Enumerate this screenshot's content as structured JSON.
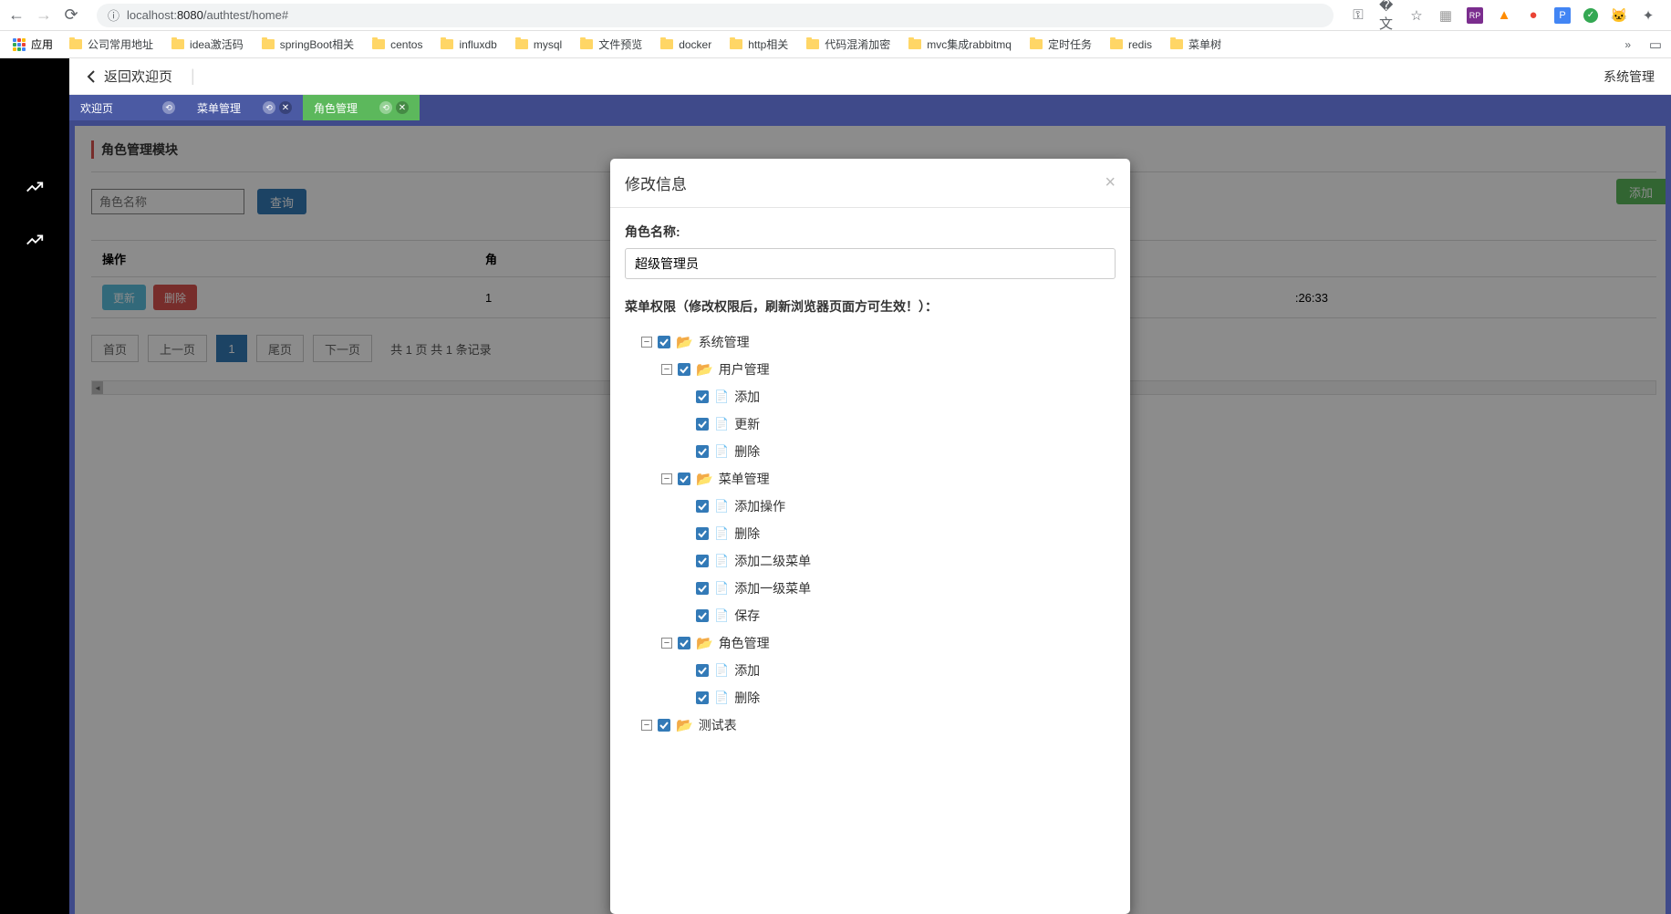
{
  "browser": {
    "url_host": "localhost:",
    "url_port": "8080",
    "url_path": "/authtest/home#"
  },
  "bookmarks": {
    "apps_label": "应用",
    "items": [
      "公司常用地址",
      "idea激活码",
      "springBoot相关",
      "centos",
      "influxdb",
      "mysql",
      "文件预览",
      "docker",
      "http相关",
      "代码混淆加密",
      "mvc集成rabbitmq",
      "定时任务",
      "redis",
      "菜单树"
    ],
    "more": "»"
  },
  "header": {
    "back_label": "返回欢迎页",
    "right_label": "系统管理"
  },
  "tabs": [
    {
      "label": "欢迎页",
      "active": false,
      "closable": false
    },
    {
      "label": "菜单管理",
      "active": false,
      "closable": true
    },
    {
      "label": "角色管理",
      "active": true,
      "closable": true
    }
  ],
  "page": {
    "module_title": "角色管理模块",
    "search_placeholder": "角色名称",
    "search_button": "查询",
    "add_button": "添加",
    "table": {
      "col_action": "操作",
      "col_role_prefix": "角",
      "time_suffix": ":26:33",
      "row_id_prefix": "1",
      "btn_update": "更新",
      "btn_delete": "删除"
    },
    "pager": {
      "first": "首页",
      "prev": "上一页",
      "cur": "1",
      "last": "尾页",
      "next": "下一页",
      "info": "共 1 页 共 1 条记录"
    }
  },
  "modal": {
    "title": "修改信息",
    "role_name_label": "角色名称:",
    "role_name_value": "超级管理员",
    "perm_title": "菜单权限（修改权限后，刷新浏览器页面方可生效！）：",
    "tree": {
      "sys_mgmt": "系统管理",
      "user_mgmt": "用户管理",
      "user_add": "添加",
      "user_update": "更新",
      "user_delete": "删除",
      "menu_mgmt": "菜单管理",
      "menu_add_op": "添加操作",
      "menu_delete": "删除",
      "menu_add_l2": "添加二级菜单",
      "menu_add_l1": "添加一级菜单",
      "menu_save": "保存",
      "role_mgmt": "角色管理",
      "role_add": "添加",
      "role_delete": "删除",
      "test_table": "测试表"
    }
  }
}
